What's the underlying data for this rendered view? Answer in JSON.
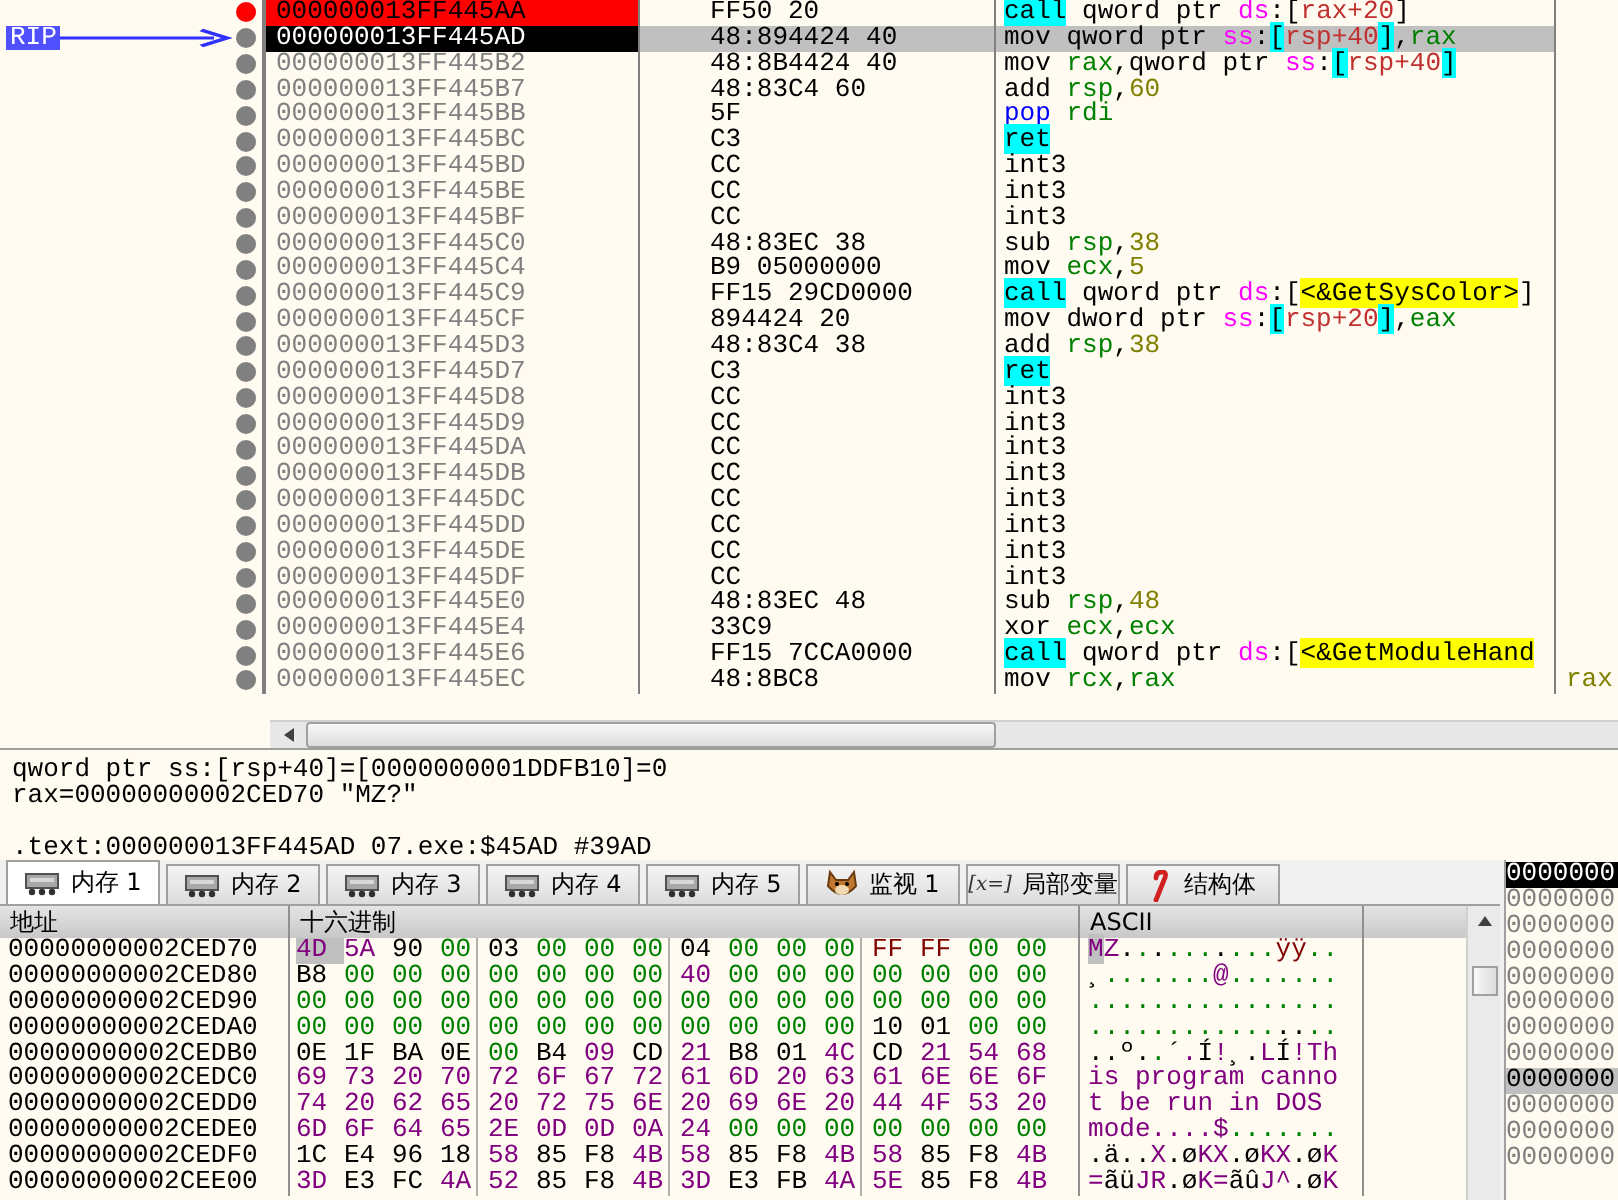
{
  "disassembly": {
    "rows": [
      {
        "address": "000000013FF445AA",
        "bytes": "FF50 20",
        "instruction": [
          {
            "text": "call",
            "kind": "hl"
          },
          {
            "text": " qword ptr ",
            "kind": "t"
          },
          {
            "text": "ds",
            "kind": "seg"
          },
          {
            "text": ":[",
            "kind": "t"
          },
          {
            "text": "rax+20",
            "kind": "mem"
          },
          {
            "text": "]",
            "kind": "t"
          }
        ],
        "breakpoint": true,
        "selected": false
      },
      {
        "address": "000000013FF445AD",
        "bytes": "48:894424 40",
        "instruction": [
          {
            "text": "mov qword ptr ",
            "kind": "t"
          },
          {
            "text": "ss",
            "kind": "seg"
          },
          {
            "text": ":",
            "kind": "t"
          },
          {
            "text": "[",
            "kind": "brk"
          },
          {
            "text": "rsp+40",
            "kind": "mem"
          },
          {
            "text": "]",
            "kind": "brk"
          },
          {
            "text": ",",
            "kind": "t"
          },
          {
            "text": "rax",
            "kind": "reg"
          }
        ],
        "breakpoint": false,
        "selected": true,
        "rip": "RIP"
      },
      {
        "address": "000000013FF445B2",
        "bytes": "48:8B4424 40",
        "instruction": [
          {
            "text": "mov ",
            "kind": "t"
          },
          {
            "text": "rax",
            "kind": "reg"
          },
          {
            "text": ",qword ptr ",
            "kind": "t"
          },
          {
            "text": "ss",
            "kind": "seg"
          },
          {
            "text": ":",
            "kind": "t"
          },
          {
            "text": "[",
            "kind": "brk"
          },
          {
            "text": "rsp+40",
            "kind": "mem"
          },
          {
            "text": "]",
            "kind": "brk"
          }
        ],
        "breakpoint": false,
        "selected": false
      },
      {
        "address": "000000013FF445B7",
        "bytes": "48:83C4 60",
        "instruction": [
          {
            "text": "add ",
            "kind": "t"
          },
          {
            "text": "rsp",
            "kind": "reg"
          },
          {
            "text": ",",
            "kind": "t"
          },
          {
            "text": "60",
            "kind": "num"
          }
        ],
        "breakpoint": false,
        "selected": false
      },
      {
        "address": "000000013FF445BB",
        "bytes": "5F",
        "instruction": [
          {
            "text": "pop ",
            "kind": "stk"
          },
          {
            "text": "rdi",
            "kind": "reg"
          }
        ],
        "breakpoint": false,
        "selected": false
      },
      {
        "address": "000000013FF445BC",
        "bytes": "C3",
        "instruction": [
          {
            "text": "ret",
            "kind": "hl"
          }
        ],
        "breakpoint": false,
        "selected": false
      },
      {
        "address": "000000013FF445BD",
        "bytes": "CC",
        "instruction": [
          {
            "text": "int3",
            "kind": "t"
          }
        ],
        "breakpoint": false,
        "selected": false
      },
      {
        "address": "000000013FF445BE",
        "bytes": "CC",
        "instruction": [
          {
            "text": "int3",
            "kind": "t"
          }
        ],
        "breakpoint": false,
        "selected": false
      },
      {
        "address": "000000013FF445BF",
        "bytes": "CC",
        "instruction": [
          {
            "text": "int3",
            "kind": "t"
          }
        ],
        "breakpoint": false,
        "selected": false
      },
      {
        "address": "000000013FF445C0",
        "bytes": "48:83EC 38",
        "instruction": [
          {
            "text": "sub ",
            "kind": "t"
          },
          {
            "text": "rsp",
            "kind": "reg"
          },
          {
            "text": ",",
            "kind": "t"
          },
          {
            "text": "38",
            "kind": "num"
          }
        ],
        "breakpoint": false,
        "selected": false
      },
      {
        "address": "000000013FF445C4",
        "bytes": "B9 05000000",
        "instruction": [
          {
            "text": "mov ",
            "kind": "t"
          },
          {
            "text": "ecx",
            "kind": "reg"
          },
          {
            "text": ",",
            "kind": "t"
          },
          {
            "text": "5",
            "kind": "num"
          }
        ],
        "breakpoint": false,
        "selected": false
      },
      {
        "address": "000000013FF445C9",
        "bytes": "FF15 29CD0000",
        "instruction": [
          {
            "text": "call",
            "kind": "hl"
          },
          {
            "text": " qword ptr ",
            "kind": "t"
          },
          {
            "text": "ds",
            "kind": "seg"
          },
          {
            "text": ":[",
            "kind": "t"
          },
          {
            "text": "<&GetSysColor>",
            "kind": "sym"
          },
          {
            "text": "]",
            "kind": "t"
          }
        ],
        "breakpoint": false,
        "selected": false
      },
      {
        "address": "000000013FF445CF",
        "bytes": "894424 20",
        "instruction": [
          {
            "text": "mov dword ptr ",
            "kind": "t"
          },
          {
            "text": "ss",
            "kind": "seg"
          },
          {
            "text": ":",
            "kind": "t"
          },
          {
            "text": "[",
            "kind": "brk"
          },
          {
            "text": "rsp+20",
            "kind": "mem"
          },
          {
            "text": "]",
            "kind": "brk"
          },
          {
            "text": ",",
            "kind": "t"
          },
          {
            "text": "eax",
            "kind": "reg"
          }
        ],
        "breakpoint": false,
        "selected": false
      },
      {
        "address": "000000013FF445D3",
        "bytes": "48:83C4 38",
        "instruction": [
          {
            "text": "add ",
            "kind": "t"
          },
          {
            "text": "rsp",
            "kind": "reg"
          },
          {
            "text": ",",
            "kind": "t"
          },
          {
            "text": "38",
            "kind": "num"
          }
        ],
        "breakpoint": false,
        "selected": false
      },
      {
        "address": "000000013FF445D7",
        "bytes": "C3",
        "instruction": [
          {
            "text": "ret",
            "kind": "hl"
          }
        ],
        "breakpoint": false,
        "selected": false
      },
      {
        "address": "000000013FF445D8",
        "bytes": "CC",
        "instruction": [
          {
            "text": "int3",
            "kind": "t"
          }
        ],
        "breakpoint": false,
        "selected": false
      },
      {
        "address": "000000013FF445D9",
        "bytes": "CC",
        "instruction": [
          {
            "text": "int3",
            "kind": "t"
          }
        ],
        "breakpoint": false,
        "selected": false
      },
      {
        "address": "000000013FF445DA",
        "bytes": "CC",
        "instruction": [
          {
            "text": "int3",
            "kind": "t"
          }
        ],
        "breakpoint": false,
        "selected": false
      },
      {
        "address": "000000013FF445DB",
        "bytes": "CC",
        "instruction": [
          {
            "text": "int3",
            "kind": "t"
          }
        ],
        "breakpoint": false,
        "selected": false
      },
      {
        "address": "000000013FF445DC",
        "bytes": "CC",
        "instruction": [
          {
            "text": "int3",
            "kind": "t"
          }
        ],
        "breakpoint": false,
        "selected": false
      },
      {
        "address": "000000013FF445DD",
        "bytes": "CC",
        "instruction": [
          {
            "text": "int3",
            "kind": "t"
          }
        ],
        "breakpoint": false,
        "selected": false
      },
      {
        "address": "000000013FF445DE",
        "bytes": "CC",
        "instruction": [
          {
            "text": "int3",
            "kind": "t"
          }
        ],
        "breakpoint": false,
        "selected": false
      },
      {
        "address": "000000013FF445DF",
        "bytes": "CC",
        "instruction": [
          {
            "text": "int3",
            "kind": "t"
          }
        ],
        "breakpoint": false,
        "selected": false
      },
      {
        "address": "000000013FF445E0",
        "bytes": "48:83EC 48",
        "instruction": [
          {
            "text": "sub ",
            "kind": "t"
          },
          {
            "text": "rsp",
            "kind": "reg"
          },
          {
            "text": ",",
            "kind": "t"
          },
          {
            "text": "48",
            "kind": "num"
          }
        ],
        "breakpoint": false,
        "selected": false
      },
      {
        "address": "000000013FF445E4",
        "bytes": "33C9",
        "instruction": [
          {
            "text": "xor ",
            "kind": "t"
          },
          {
            "text": "ecx",
            "kind": "reg"
          },
          {
            "text": ",",
            "kind": "t"
          },
          {
            "text": "ecx",
            "kind": "reg"
          }
        ],
        "breakpoint": false,
        "selected": false
      },
      {
        "address": "000000013FF445E6",
        "bytes": "FF15 7CCA0000",
        "instruction": [
          {
            "text": "call",
            "kind": "hl"
          },
          {
            "text": " qword ptr ",
            "kind": "t"
          },
          {
            "text": "ds",
            "kind": "seg"
          },
          {
            "text": ":[",
            "kind": "t"
          },
          {
            "text": "<&GetModuleHand",
            "kind": "sym"
          }
        ],
        "breakpoint": false,
        "selected": false
      },
      {
        "address": "000000013FF445EC",
        "bytes": "48:8BC8",
        "instruction": [
          {
            "text": "mov ",
            "kind": "t"
          },
          {
            "text": "rcx",
            "kind": "reg"
          },
          {
            "text": ",",
            "kind": "t"
          },
          {
            "text": "rax",
            "kind": "reg"
          }
        ],
        "breakpoint": false,
        "selected": false,
        "comment": "rax"
      }
    ]
  },
  "info": {
    "lines": [
      "qword ptr ss:[rsp+40]=[0000000001DDFB10]=0",
      "rax=00000000002CED70 \"MZ?\""
    ],
    "section": ".text:000000013FF445AD 07.exe:$45AD #39AD"
  },
  "tabs": [
    {
      "label": "内存 1",
      "kind": "memory",
      "selected": true
    },
    {
      "label": "内存 2",
      "kind": "memory",
      "selected": false
    },
    {
      "label": "内存 3",
      "kind": "memory",
      "selected": false
    },
    {
      "label": "内存 4",
      "kind": "memory",
      "selected": false
    },
    {
      "label": "内存 5",
      "kind": "memory",
      "selected": false
    },
    {
      "label": "监视 1",
      "kind": "watch",
      "selected": false
    },
    {
      "label": "局部变量",
      "kind": "locals",
      "icon_text": "[x=]",
      "selected": false
    },
    {
      "label": "结构体",
      "kind": "struct",
      "selected": false
    }
  ],
  "dump": {
    "columns": [
      "地址",
      "十六进制",
      "ASCII"
    ],
    "rows": [
      {
        "address": "00000000002CED70",
        "bytes": "4D 5A 90 00 03 00 00 00 04 00 00 00 FF FF 00 00",
        "ascii": "MZ..........ÿÿ..",
        "cursor": true
      },
      {
        "address": "00000000002CED80",
        "bytes": "B8 00 00 00 00 00 00 00 40 00 00 00 00 00 00 00",
        "ascii": "¸.......@.......",
        "cursor": false
      },
      {
        "address": "00000000002CED90",
        "bytes": "00 00 00 00 00 00 00 00 00 00 00 00 00 00 00 00",
        "ascii": "................",
        "cursor": false
      },
      {
        "address": "00000000002CEDA0",
        "bytes": "00 00 00 00 00 00 00 00 00 00 00 00 10 01 00 00",
        "ascii": "................",
        "cursor": false
      },
      {
        "address": "00000000002CEDB0",
        "bytes": "0E 1F BA 0E 00 B4 09 CD 21 B8 01 4C CD 21 54 68",
        "ascii": "..º..´.Í!¸.LÍ!Th",
        "cursor": false
      },
      {
        "address": "00000000002CEDC0",
        "bytes": "69 73 20 70 72 6F 67 72 61 6D 20 63 61 6E 6E 6F",
        "ascii": "is program canno",
        "cursor": false
      },
      {
        "address": "00000000002CEDD0",
        "bytes": "74 20 62 65 20 72 75 6E 20 69 6E 20 44 4F 53 20",
        "ascii": "t be run in DOS ",
        "cursor": false
      },
      {
        "address": "00000000002CEDE0",
        "bytes": "6D 6F 64 65 2E 0D 0D 0A 24 00 00 00 00 00 00 00",
        "ascii": "mode....$.......",
        "cursor": false
      },
      {
        "address": "00000000002CEDF0",
        "bytes": "1C E4 96 18 58 85 F8 4B 58 85 F8 4B 58 85 F8 4B",
        "ascii": ".ä..X.øKX.øKX.øK",
        "cursor": false
      },
      {
        "address": "00000000002CEE00",
        "bytes": "3D E3 FC 4A 52 85 F8 4B 3D E3 FB 4A 5E 85 F8 4B",
        "ascii": "=ãüJR.øK=ãûJ^.øK",
        "cursor": false
      }
    ]
  },
  "stack": [
    {
      "text": "0000000",
      "selected": true,
      "current": false
    },
    {
      "text": "0000000",
      "selected": false,
      "current": false
    },
    {
      "text": "0000000",
      "selected": false,
      "current": false
    },
    {
      "text": "0000000",
      "selected": false,
      "current": false
    },
    {
      "text": "0000000",
      "selected": false,
      "current": false
    },
    {
      "text": "0000000",
      "selected": false,
      "current": false
    },
    {
      "text": "0000000",
      "selected": false,
      "current": false
    },
    {
      "text": "0000000",
      "selected": false,
      "current": false
    },
    {
      "text": "0000000",
      "selected": false,
      "current": true
    },
    {
      "text": "0000000",
      "selected": false,
      "current": false
    },
    {
      "text": "0000000",
      "selected": false,
      "current": false
    },
    {
      "text": "0000000",
      "selected": false,
      "current": false
    }
  ]
}
